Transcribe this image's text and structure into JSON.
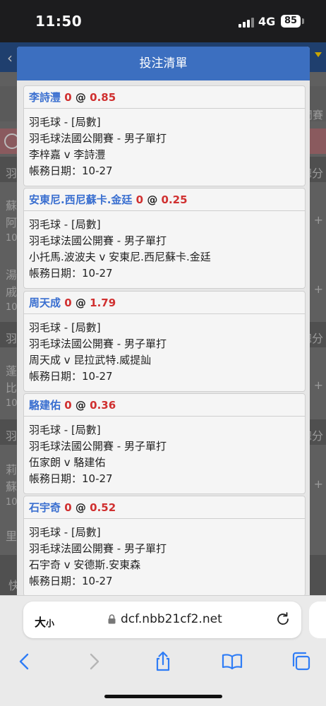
{
  "status": {
    "time": "11:50",
    "network": "4G",
    "battery": "85"
  },
  "background": {
    "rows": [
      {
        "left": "羽",
        "right": "總分"
      },
      {
        "left": "蘇",
        "right": ""
      },
      {
        "left": "阿",
        "right": "+"
      },
      {
        "left": "10",
        "right": ""
      },
      {
        "left": "湯",
        "right": ""
      },
      {
        "left": "戚",
        "right": "+"
      },
      {
        "left": "10",
        "right": ""
      },
      {
        "left": "羽",
        "right": "總分"
      },
      {
        "left": "蓬",
        "right": ""
      },
      {
        "left": "比",
        "right": "+"
      },
      {
        "left": "10",
        "right": ""
      },
      {
        "left": "羽",
        "right": "總分"
      },
      {
        "left": "莉",
        "right": ""
      },
      {
        "left": "蘇",
        "right": "+"
      },
      {
        "left": "10",
        "right": ""
      },
      {
        "left": "里",
        "right": ""
      },
      {
        "left": "快",
        "right": ""
      }
    ],
    "right_label": "閒賽"
  },
  "modal": {
    "title": "投注清單",
    "bets": [
      {
        "name": "李詩灃",
        "stake": "0",
        "at": "@",
        "odds": "0.85",
        "sport": "羽毛球 - [局數]",
        "event": "羽毛球法國公開賽 - 男子單打",
        "match": "李梓嘉 v 李詩灃",
        "date": "帳務日期：10-27"
      },
      {
        "name": "安東尼.西尼蘇卡.金廷",
        "stake": "0",
        "at": "@",
        "odds": "0.25",
        "sport": "羽毛球 - [局數]",
        "event": "羽毛球法國公開賽 - 男子單打",
        "match": "小托馬.波波夫 v 安東尼.西尼蘇卡.金廷",
        "date": "帳務日期：10-27"
      },
      {
        "name": "周天成",
        "stake": "0",
        "at": "@",
        "odds": "1.79",
        "sport": "羽毛球 - [局數]",
        "event": "羽毛球法國公開賽 - 男子單打",
        "match": "周天成 v 昆拉武特.威提訕",
        "date": "帳務日期：10-27"
      },
      {
        "name": "駱建佑",
        "stake": "0",
        "at": "@",
        "odds": "0.36",
        "sport": "羽毛球 - [局數]",
        "event": "羽毛球法國公開賽 - 男子單打",
        "match": "伍家朗 v 駱建佑",
        "date": "帳務日期：10-27"
      },
      {
        "name": "石宇奇",
        "stake": "0",
        "at": "@",
        "odds": "0.52",
        "sport": "羽毛球 - [局數]",
        "event": "羽毛球法國公開賽 - 男子單打",
        "match": "石宇奇 v 安德斯.安東森",
        "date": "帳務日期：10-27"
      }
    ]
  },
  "browser": {
    "text_size_label": "大",
    "text_size_small": "小",
    "url": "dcf.nbb21cf2.net"
  },
  "icons": {
    "back": "chevron-left-icon",
    "forward": "chevron-right-icon",
    "share": "share-icon",
    "bookmarks": "book-icon",
    "tabs": "tabs-icon",
    "lock": "lock-icon",
    "reload": "reload-icon"
  },
  "colors": {
    "modal_header": "#3c6fc0",
    "name": "#3a6fd0",
    "odds": "#d03030"
  }
}
